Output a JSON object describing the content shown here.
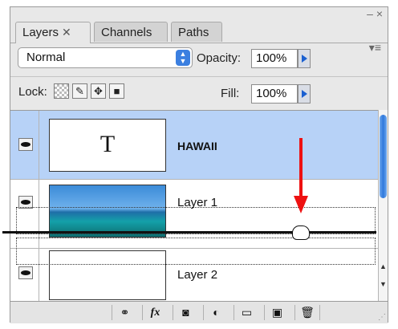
{
  "panel": {
    "tabs": [
      {
        "label": "Layers",
        "close": "✕"
      },
      {
        "label": "Channels"
      },
      {
        "label": "Paths"
      }
    ],
    "menu_icon": "panel-menu-icon",
    "collapse_glyph": "– ×"
  },
  "blend": {
    "mode": "Normal",
    "opacity_label": "Opacity:",
    "opacity_value": "100%"
  },
  "lock": {
    "label": "Lock:",
    "fill_label": "Fill:",
    "fill_value": "100%",
    "icons": [
      "lock-transparent-icon",
      "lock-image-icon",
      "lock-position-icon",
      "lock-all-icon"
    ]
  },
  "layers": [
    {
      "name": "HAWAII",
      "thumb_text": "T",
      "type": "text",
      "selected": true,
      "visible": true
    },
    {
      "name": "Layer 1",
      "type": "image",
      "selected": false,
      "visible": true
    },
    {
      "name": "Layer 2",
      "type": "blank",
      "selected": false,
      "visible": true
    }
  ],
  "footer_buttons": [
    "link-layers-icon",
    "fx-icon",
    "add-mask-icon",
    "adjustment-layer-icon",
    "new-group-icon",
    "new-layer-icon",
    "trash-icon"
  ],
  "footer_fx_label": "fx",
  "colors": {
    "selected_row": "#b7d2f7",
    "accent": "#3b7fe0",
    "drag_arrow": "#ee1111"
  }
}
